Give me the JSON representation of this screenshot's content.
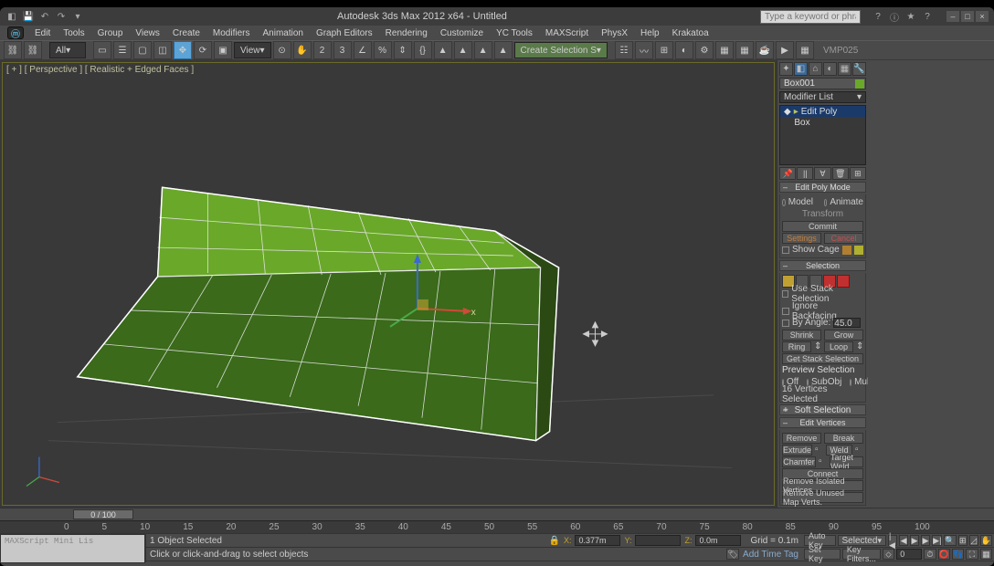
{
  "title": "Autodesk 3ds Max 2012 x64 - Untitled",
  "search_placeholder": "Type a keyword or phrase",
  "menu": [
    "Edit",
    "Tools",
    "Group",
    "Views",
    "Create",
    "Modifiers",
    "Animation",
    "Graph Editors",
    "Rendering",
    "Customize",
    "YC Tools",
    "MAXScript",
    "PhysX",
    "Help",
    "Krakatoa"
  ],
  "tool_all": "All",
  "tool_view": "View",
  "tool_selfilter": "Create Selection S",
  "tool_label_right": "VMP025",
  "viewport_label": "[ + ] [ Perspective ] [ Realistic + Edged Faces ]",
  "object_name": "Box001",
  "modifier_list_label": "Modifier List",
  "stack": {
    "edit_poly": "Edit Poly",
    "box": "Box"
  },
  "edit_poly_mode": {
    "header": "Edit Poly Mode",
    "model": "Model",
    "animate": "Animate",
    "transform": "Transform",
    "commit": "Commit",
    "settings": "Settings",
    "cancel": "Cancel",
    "show_cage": "Show Cage"
  },
  "selection": {
    "header": "Selection",
    "use_stack": "Use Stack Selection",
    "ignore_backfacing": "Ignore Backfacing",
    "by_angle": "By Angle:",
    "angle_val": "45.0",
    "shrink": "Shrink",
    "grow": "Grow",
    "ring": "Ring",
    "loop": "Loop",
    "get_stack": "Get Stack Selection",
    "preview": "Preview Selection",
    "off": "Off",
    "subobj": "SubObj",
    "multi": "Multi",
    "count": "16 Vertices Selected"
  },
  "soft_sel_header": "Soft Selection",
  "edit_verts": {
    "header": "Edit Vertices",
    "remove": "Remove",
    "break": "Break",
    "extrude": "Extrude",
    "weld": "Weld",
    "chamfer": "Chamfer",
    "target_weld": "Target Weld",
    "connect": "Connect",
    "remove_iso": "Remove Isolated Vertices",
    "remove_map": "Remove Unused Map Verts."
  },
  "time_slider": "0 / 100",
  "ruler_ticks": [
    "0",
    "5",
    "10",
    "15",
    "20",
    "25",
    "30",
    "35",
    "40",
    "45",
    "50",
    "55",
    "60",
    "65",
    "70",
    "75",
    "80",
    "85",
    "90",
    "95",
    "100"
  ],
  "status": {
    "objects": "1 Object Selected",
    "prompt": "Click or click-and-drag to select objects",
    "x": "0.377m",
    "y": "",
    "z": "0.0m",
    "grid": "Grid = 0.1m",
    "add_time_tag": "Add Time Tag",
    "auto_key": "Auto Key",
    "selected": "Selected",
    "set_key": "Set Key",
    "key_filters": "Key Filters..."
  },
  "script_label": "MAXScript Mini Lis"
}
